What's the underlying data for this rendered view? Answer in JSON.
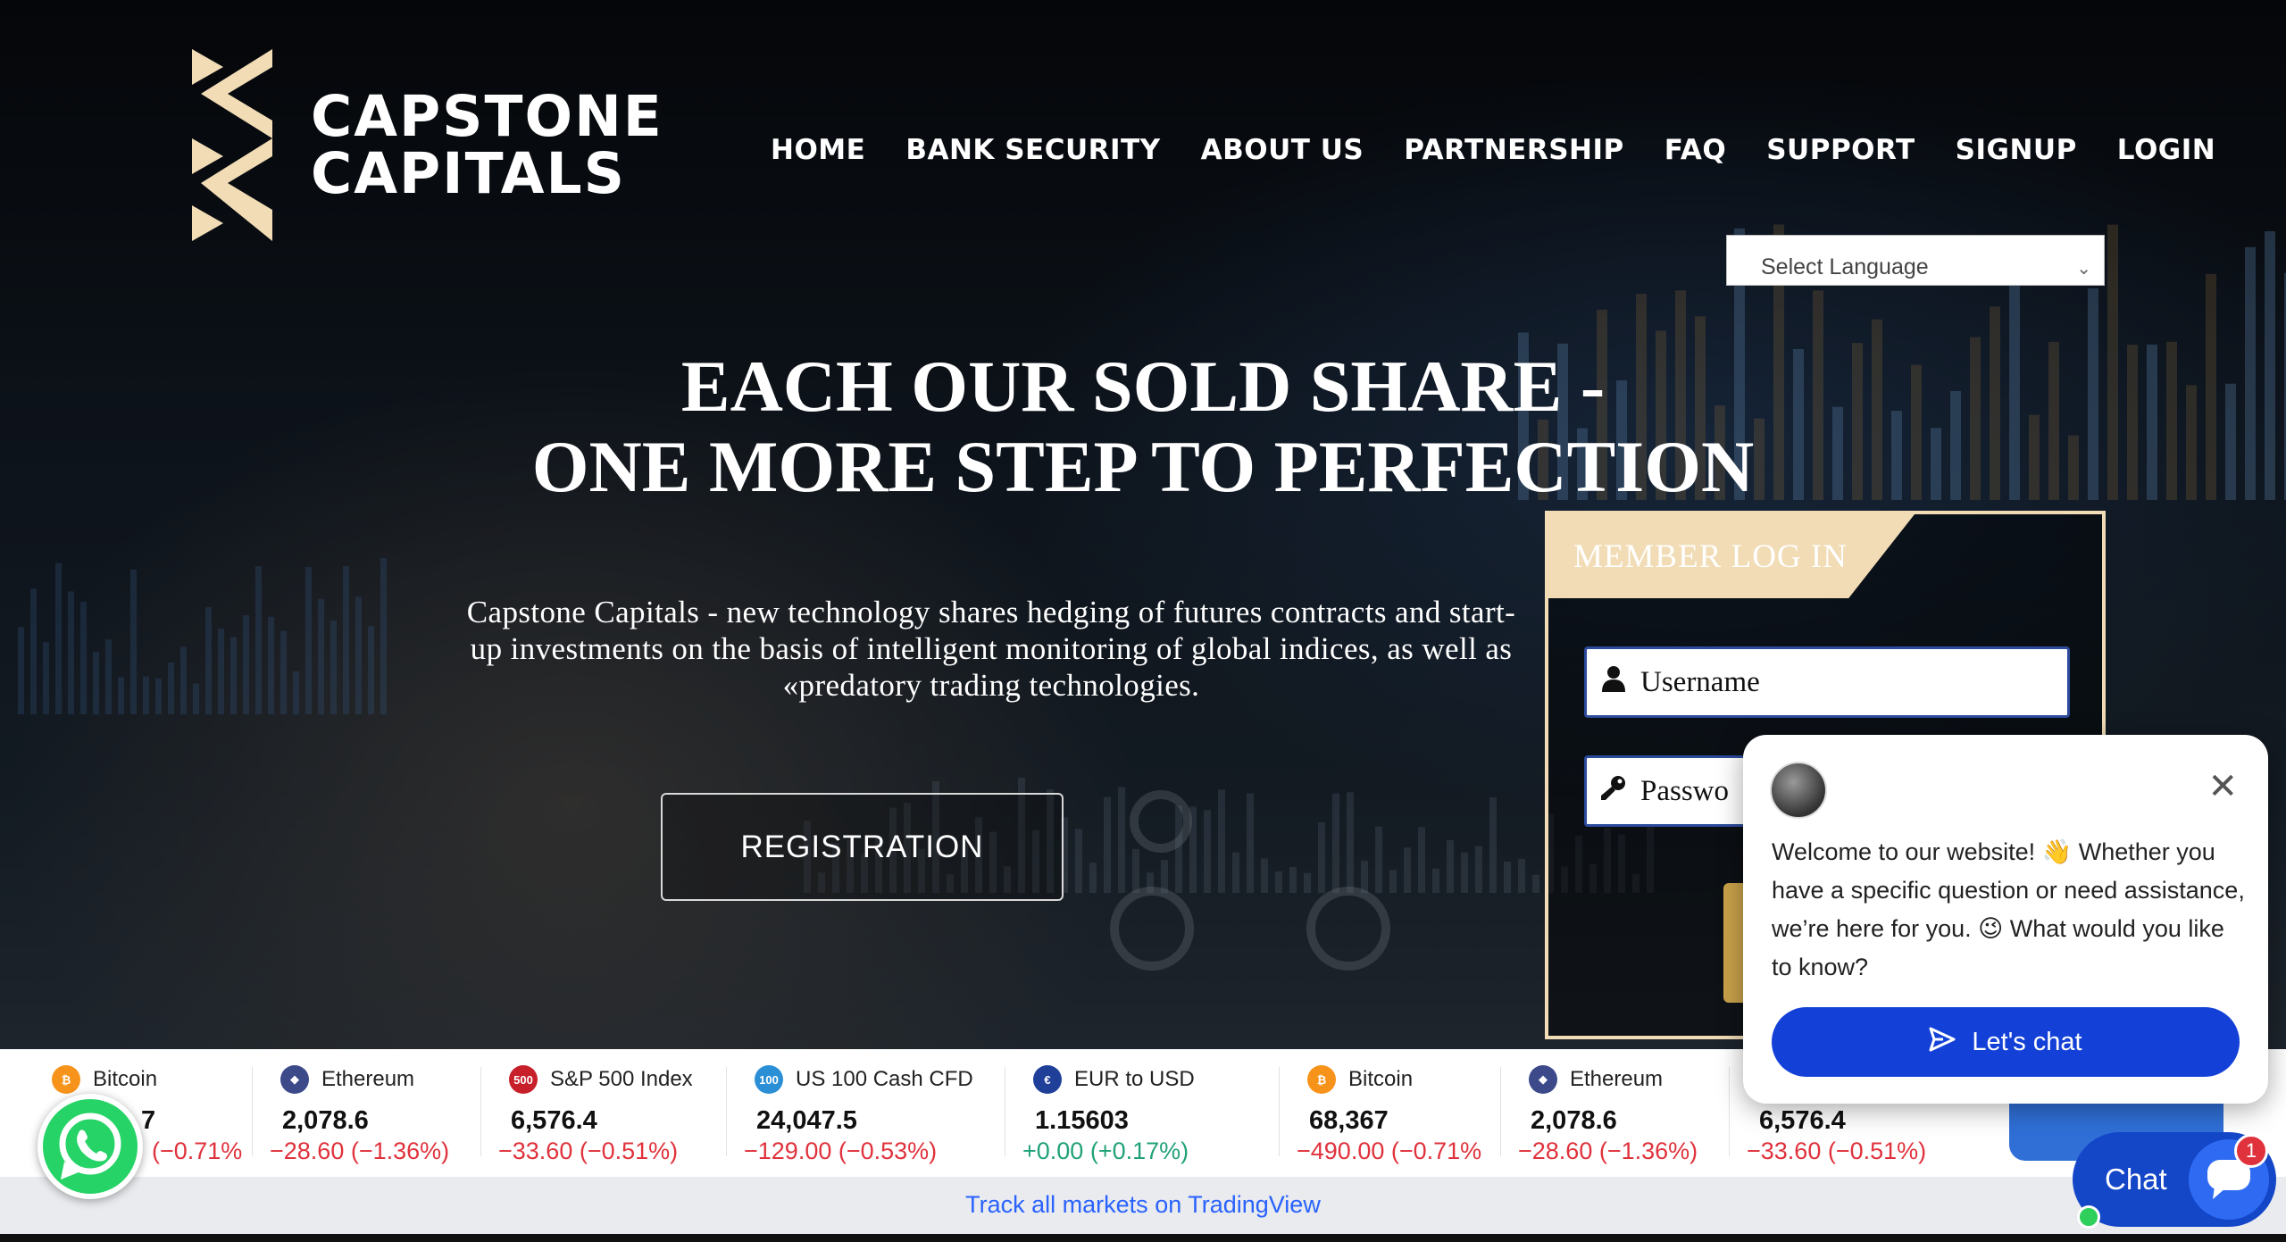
{
  "brand": {
    "line1": "CAPSTONE",
    "line2": "CAPITALS",
    "accent": "#f1dcb6"
  },
  "nav": {
    "items": [
      "HOME",
      "BANK SECURITY",
      "ABOUT US",
      "PARTNERSHIP",
      "FAQ",
      "SUPPORT",
      "SIGNUP",
      "LOGIN"
    ]
  },
  "language_select": {
    "value": "Select Language"
  },
  "hero": {
    "headline_1": "EACH OUR SOLD SHARE -",
    "headline_2": "ONE MORE STEP TO PERFECTION",
    "intro_1": "Capstone Capitals - new technology shares hedging of futures contracts and start-",
    "intro_2": "up investments on the basis of intelligent monitoring of global indices, as well as",
    "intro_3": "«predatory trading technologies.",
    "registration_label": "REGISTRATION"
  },
  "login": {
    "title": "MEMBER LOG IN",
    "username_placeholder": "Username",
    "password_placeholder": "Passwo"
  },
  "ticker": {
    "items": [
      {
        "name": "Bitcoin",
        "price": "7",
        "change": "(−0.71%",
        "dir": "neg",
        "icon_color": "#f7931a",
        "icon_text": "₿"
      },
      {
        "name": "Ethereum",
        "price": "2,078.6",
        "change": "−28.60 (−1.36%)",
        "dir": "neg",
        "icon_color": "#3c4a8a",
        "icon_text": "◆"
      },
      {
        "name": "S&P 500 Index",
        "price": "6,576.4",
        "change": "−33.60 (−0.51%)",
        "dir": "neg",
        "icon_color": "#c8202b",
        "icon_text": "500"
      },
      {
        "name": "US 100 Cash CFD",
        "price": "24,047.5",
        "change": "−129.00 (−0.53%)",
        "dir": "neg",
        "icon_color": "#2b8fd6",
        "icon_text": "100"
      },
      {
        "name": "EUR to USD",
        "price": "1.15603",
        "change": "+0.00 (+0.17%)",
        "dir": "pos",
        "icon_color": "#1f3f99",
        "icon_text": "€"
      },
      {
        "name": "Bitcoin",
        "price": "68,367",
        "change": "−490.00 (−0.71%",
        "dir": "neg",
        "icon_color": "#f7931a",
        "icon_text": "₿"
      },
      {
        "name": "Ethereum",
        "price": "2,078.6",
        "change": "−28.60 (−1.36%)",
        "dir": "neg",
        "icon_color": "#3c4a8a",
        "icon_text": "◆"
      },
      {
        "name": "",
        "price": "6,576.4",
        "change": "−33.60 (−0.51%)",
        "dir": "neg",
        "icon_color": "#c8202b",
        "icon_text": ""
      }
    ],
    "tradingview_link": "Track all markets on TradingView"
  },
  "chat": {
    "message": "Welcome to our website! 👋 Whether you have a specific question or need assistance, we’re here for you. 😉 What would you like to know?",
    "cta": "Let's chat",
    "launcher_label": "Chat",
    "badge": "1",
    "accent": "#1341d8"
  },
  "icons": {
    "username": "user-icon",
    "password": "key-icon",
    "whatsapp": "whatsapp-icon",
    "close": "close-icon",
    "send": "send-icon",
    "chat": "chat-bubble-icon"
  }
}
